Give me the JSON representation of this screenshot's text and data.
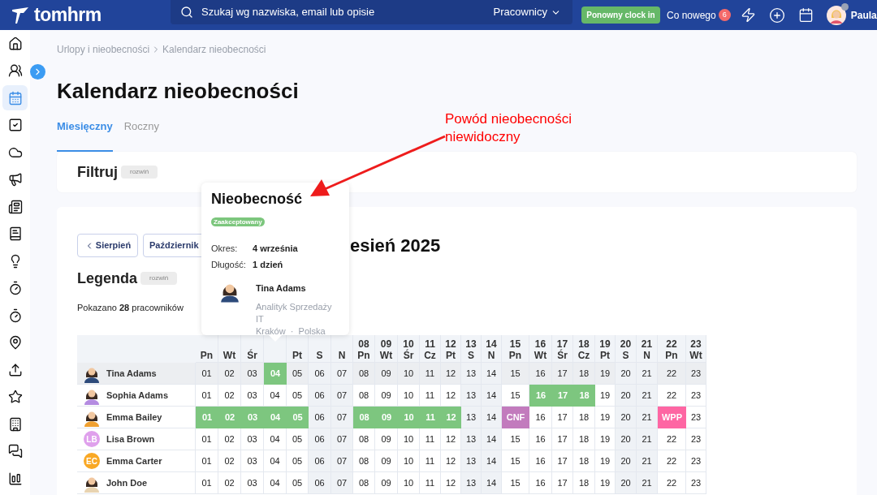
{
  "topbar": {
    "logo": "tomhrm",
    "search": {
      "placeholder": "Szukaj wg nazwiska, email lub opisie",
      "scope": "Pracownicy"
    },
    "clock_button": "Ponowny clock in",
    "whats_new": {
      "label": "Co nowego",
      "count": "6"
    },
    "user": "Paula"
  },
  "sidebar": {
    "items": [
      {
        "selected": false
      },
      {
        "selected": false
      },
      {
        "selected": true
      },
      {
        "selected": false
      },
      {
        "selected": false
      },
      {
        "selected": false
      },
      {
        "selected": false
      },
      {
        "selected": false
      },
      {
        "selected": false
      },
      {
        "selected": false
      },
      {
        "selected": false
      },
      {
        "selected": false
      },
      {
        "selected": false
      },
      {
        "selected": false
      },
      {
        "selected": false
      },
      {
        "selected": false
      },
      {
        "selected": false
      }
    ]
  },
  "breadcrumb": [
    "Urlopy i nieobecności",
    "Kalendarz nieobecności"
  ],
  "title": "Kalendarz nieobecności",
  "tabs": [
    {
      "label": "Miesięczny",
      "selected": true
    },
    {
      "label": "Roczny",
      "selected": false
    }
  ],
  "filter": {
    "title": "Filtruj",
    "toggle": "rozwiń"
  },
  "calendar": {
    "prev": "Sierpień",
    "next": "Październik",
    "month": "esień 2025",
    "legend": {
      "title": "Legenda",
      "toggle": "rozwiń"
    },
    "count_text": "Pokazano **28** pracowników",
    "columns": [
      {
        "weekday": "Pn",
        "weekend": false
      },
      {
        "weekday": "Wt",
        "weekend": false
      },
      {
        "weekday": "Śr",
        "weekend": false
      },
      {
        "weekend": false
      },
      {
        "weekday": "Pt",
        "weekend": false
      },
      {
        "weekday": "S",
        "weekend": true
      },
      {
        "weekday": "N",
        "weekend": true
      },
      {
        "day": "08",
        "weekday": "Pn",
        "weekend": false
      },
      {
        "day": "09",
        "weekday": "Wt",
        "weekend": false
      },
      {
        "day": "10",
        "weekday": "Śr",
        "weekend": false
      },
      {
        "day": "11",
        "weekday": "Cz",
        "weekend": false
      },
      {
        "day": "12",
        "weekday": "Pt",
        "weekend": false
      },
      {
        "day": "13",
        "weekday": "S",
        "weekend": true
      },
      {
        "day": "14",
        "weekday": "N",
        "weekend": true
      },
      {
        "day": "15",
        "weekday": "Pn",
        "weekend": false
      },
      {
        "day": "16",
        "weekday": "Wt",
        "weekend": false
      },
      {
        "day": "17",
        "weekday": "Śr",
        "weekend": false
      },
      {
        "day": "18",
        "weekday": "Cz",
        "weekend": false
      },
      {
        "day": "19",
        "weekday": "Pt",
        "weekend": false
      },
      {
        "day": "20",
        "weekday": "S",
        "weekend": true
      },
      {
        "day": "21",
        "weekday": "N",
        "weekend": true
      },
      {
        "day": "22",
        "weekday": "Pn",
        "weekend": false
      },
      {
        "day": "23",
        "weekday": "Wt",
        "weekend": false
      }
    ],
    "rows": [
      {
        "name": "Tina Adams",
        "selected": true,
        "avatar": {
          "kind": "figure",
          "color": "#2d4a7a"
        },
        "cells": [
          {
            "text": "01"
          },
          {
            "text": "02"
          },
          {
            "text": "03"
          },
          {
            "text": "04",
            "color": "#7dc67f"
          },
          {
            "text": "05"
          },
          {
            "text": "06"
          },
          {
            "text": "07"
          },
          {
            "text": "08"
          },
          {
            "text": "09"
          },
          {
            "text": "10"
          },
          {
            "text": "11"
          },
          {
            "text": "12"
          },
          {
            "text": "13"
          },
          {
            "text": "14"
          },
          {
            "text": "15"
          },
          {
            "text": "16"
          },
          {
            "text": "17"
          },
          {
            "text": "18"
          },
          {
            "text": "19"
          },
          {
            "text": "20"
          },
          {
            "text": "21"
          },
          {
            "text": "22"
          },
          {
            "text": "23"
          }
        ]
      },
      {
        "name": "Sophia Adams",
        "selected": false,
        "avatar": {
          "kind": "figure",
          "color": "#b48be0"
        },
        "cells": [
          {
            "text": "01"
          },
          {
            "text": "02"
          },
          {
            "text": "03"
          },
          {
            "text": "04"
          },
          {
            "text": "05"
          },
          {
            "text": "06"
          },
          {
            "text": "07"
          },
          {
            "text": "08"
          },
          {
            "text": "09"
          },
          {
            "text": "10"
          },
          {
            "text": "11"
          },
          {
            "text": "12"
          },
          {
            "text": "13"
          },
          {
            "text": "14"
          },
          {
            "text": "15"
          },
          {
            "text": "16",
            "color": "#7dc67f"
          },
          {
            "text": "17",
            "color": "#7dc67f"
          },
          {
            "text": "18",
            "color": "#7dc67f"
          },
          {
            "text": "19"
          },
          {
            "text": "20"
          },
          {
            "text": "21"
          },
          {
            "text": "22"
          },
          {
            "text": "23"
          }
        ]
      },
      {
        "name": "Emma Bailey",
        "selected": false,
        "avatar": {
          "kind": "figure",
          "color": "#f0a030"
        },
        "cells": [
          {
            "text": "01",
            "color": "#7dc67f"
          },
          {
            "text": "02",
            "color": "#7dc67f"
          },
          {
            "text": "03",
            "color": "#7dc67f"
          },
          {
            "text": "04",
            "color": "#7dc67f"
          },
          {
            "text": "05",
            "color": "#7dc67f"
          },
          {
            "text": "06"
          },
          {
            "text": "07"
          },
          {
            "text": "08",
            "color": "#7dc67f"
          },
          {
            "text": "09",
            "color": "#7dc67f"
          },
          {
            "text": "10",
            "color": "#7dc67f"
          },
          {
            "text": "11",
            "color": "#7dc67f"
          },
          {
            "text": "12",
            "color": "#7dc67f"
          },
          {
            "text": "13"
          },
          {
            "text": "14"
          },
          {
            "text": "CNF",
            "color": "#c27bbd"
          },
          {
            "text": "16"
          },
          {
            "text": "17"
          },
          {
            "text": "18"
          },
          {
            "text": "19"
          },
          {
            "text": "20"
          },
          {
            "text": "21"
          },
          {
            "text": "WPP",
            "color": "#fe66a3"
          },
          {
            "text": "23"
          }
        ]
      },
      {
        "name": "Lisa Brown",
        "selected": false,
        "avatar": {
          "kind": "initials",
          "text": "LB",
          "color": "#dfa0ec"
        },
        "cells": [
          {
            "text": "01"
          },
          {
            "text": "02"
          },
          {
            "text": "03"
          },
          {
            "text": "04"
          },
          {
            "text": "05"
          },
          {
            "text": "06"
          },
          {
            "text": "07"
          },
          {
            "text": "08"
          },
          {
            "text": "09"
          },
          {
            "text": "10"
          },
          {
            "text": "11"
          },
          {
            "text": "12"
          },
          {
            "text": "13"
          },
          {
            "text": "14"
          },
          {
            "text": "15"
          },
          {
            "text": "16"
          },
          {
            "text": "17"
          },
          {
            "text": "18"
          },
          {
            "text": "19"
          },
          {
            "text": "20"
          },
          {
            "text": "21"
          },
          {
            "text": "22"
          },
          {
            "text": "23"
          }
        ]
      },
      {
        "name": "Emma Carter",
        "selected": false,
        "avatar": {
          "kind": "initials",
          "text": "EC",
          "color": "#f9a825"
        },
        "cells": [
          {
            "text": "01"
          },
          {
            "text": "02"
          },
          {
            "text": "03"
          },
          {
            "text": "04"
          },
          {
            "text": "05"
          },
          {
            "text": "06"
          },
          {
            "text": "07"
          },
          {
            "text": "08"
          },
          {
            "text": "09"
          },
          {
            "text": "10"
          },
          {
            "text": "11"
          },
          {
            "text": "12"
          },
          {
            "text": "13"
          },
          {
            "text": "14"
          },
          {
            "text": "15"
          },
          {
            "text": "16"
          },
          {
            "text": "17"
          },
          {
            "text": "18"
          },
          {
            "text": "19"
          },
          {
            "text": "20"
          },
          {
            "text": "21"
          },
          {
            "text": "22"
          },
          {
            "text": "23"
          }
        ]
      },
      {
        "name": "John Doe",
        "selected": false,
        "avatar": {
          "kind": "figure",
          "color": "#e8d3b0"
        },
        "cells": [
          {
            "text": "01"
          },
          {
            "text": "02"
          },
          {
            "text": "03"
          },
          {
            "text": "04"
          },
          {
            "text": "05"
          },
          {
            "text": "06"
          },
          {
            "text": "07"
          },
          {
            "text": "08"
          },
          {
            "text": "09"
          },
          {
            "text": "10"
          },
          {
            "text": "11"
          },
          {
            "text": "12"
          },
          {
            "text": "13"
          },
          {
            "text": "14"
          },
          {
            "text": "15"
          },
          {
            "text": "16"
          },
          {
            "text": "17"
          },
          {
            "text": "18"
          },
          {
            "text": "19"
          },
          {
            "text": "20"
          },
          {
            "text": "21"
          },
          {
            "text": "22"
          },
          {
            "text": "23"
          }
        ]
      }
    ]
  },
  "popover": {
    "title": "Nieobecność",
    "status": "Zaakceptowany",
    "fields": [
      {
        "label": "Okres:",
        "value": "4 września"
      },
      {
        "label": "Długość:",
        "value": "1 dzień"
      }
    ],
    "employee": {
      "name": "Tina Adams",
      "avatar": {
        "kind": "figure",
        "color": "#2d4a7a"
      },
      "position": "Analityk Sprzedaży",
      "department": "IT",
      "location": "Kraków  ·  Polska"
    }
  },
  "annotation": {
    "text": "Powód nieobecności niewidoczny"
  }
}
